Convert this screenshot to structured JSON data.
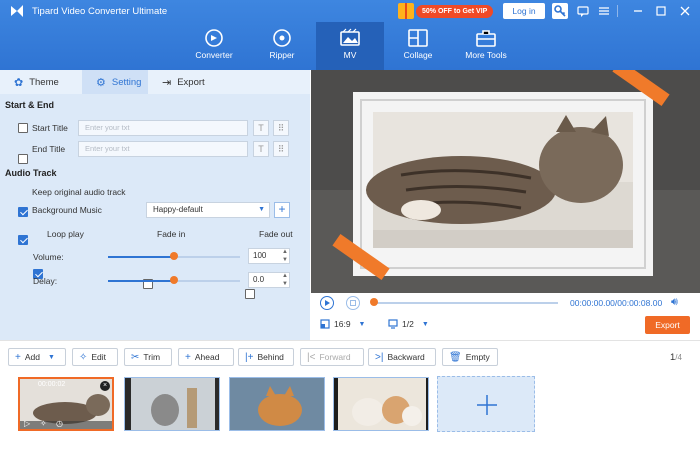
{
  "app": {
    "title": "Tipard Video Converter Ultimate"
  },
  "promo": {
    "text": "50% OFF to Get VIP"
  },
  "header": {
    "login_label": "Log in"
  },
  "nav": [
    {
      "label": "Converter",
      "icon": "converter-icon"
    },
    {
      "label": "Ripper",
      "icon": "disc-icon"
    },
    {
      "label": "MV",
      "icon": "mv-icon",
      "active": true
    },
    {
      "label": "Collage",
      "icon": "collage-icon"
    },
    {
      "label": "More Tools",
      "icon": "toolbox-icon"
    }
  ],
  "panel_tabs": [
    {
      "label": "Theme",
      "icon": "theme-icon"
    },
    {
      "label": "Setting",
      "icon": "gear-icon",
      "active": true
    },
    {
      "label": "Export",
      "icon": "export-icon"
    }
  ],
  "start_end": {
    "heading": "Start & End",
    "start_label": "Start Title",
    "start_placeholder": "Enter your txt",
    "end_label": "End Title",
    "end_placeholder": "Enter your txt"
  },
  "audio": {
    "heading": "Audio Track",
    "keep_label": "Keep original audio track",
    "keep_checked": true,
    "bg_label": "Background Music",
    "bg_checked": true,
    "music": "Happy-default",
    "loop_label": "Loop play",
    "loop_checked": true,
    "fadein_label": "Fade in",
    "fadeout_label": "Fade out",
    "volume_label": "Volume:",
    "volume_value": "100",
    "volume_level": 0.5,
    "delay_label": "Delay:",
    "delay_value": "0.0",
    "delay_level": 0.5
  },
  "player": {
    "time": "00:00:00.00/00:00:08.00",
    "progress": 0.0,
    "ratio": "16:9",
    "page": "1/2",
    "export_label": "Export"
  },
  "toolbar": {
    "add": "Add",
    "edit": "Edit",
    "trim": "Trim",
    "ahead": "Ahead",
    "behind": "Behind",
    "forward": "Forward",
    "backward": "Backward",
    "empty": "Empty",
    "page_current": "1",
    "page_total": "4"
  },
  "timeline": {
    "first_duration": "00:00:02"
  },
  "colors": {
    "accent": "#2f74d3",
    "orange": "#f06a26",
    "promo": "#f04a26"
  }
}
